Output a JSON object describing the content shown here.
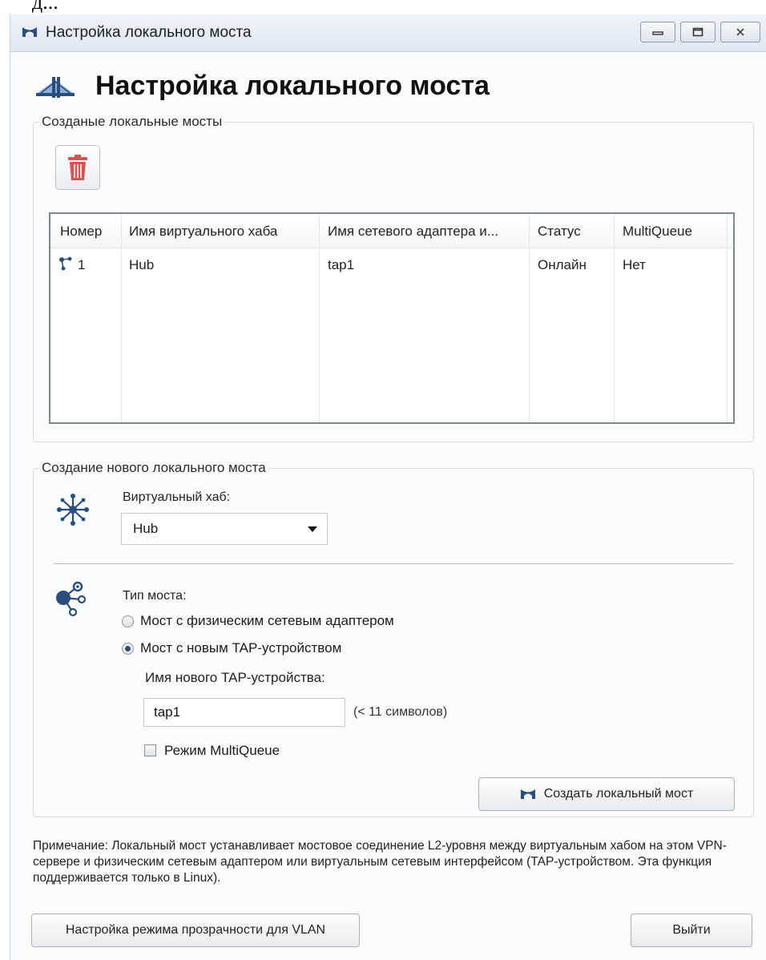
{
  "window": {
    "title": "Настройка локального моста",
    "controls": [
      "minimize",
      "maximize",
      "close"
    ]
  },
  "page": {
    "title": "Настройка локального моста"
  },
  "existing_bridges": {
    "legend": "Созданые локальные мосты",
    "columns": [
      "Номер",
      "Имя виртуального хаба",
      "Имя сетевого адаптера и...",
      "Статус",
      "MultiQueue"
    ],
    "rows": [
      {
        "number": "1",
        "hub": "Hub",
        "adapter": "tap1",
        "status": "Онлайн",
        "multiqueue": "Нет"
      }
    ]
  },
  "new_bridge": {
    "legend": "Создание нового локального моста",
    "hub_label": "Виртуальный хаб:",
    "hub_value": "Hub",
    "type_label": "Тип моста:",
    "option_physical": "Мост с физическим сетевым адаптером",
    "option_tap": "Мост с новым TAP-устройством",
    "selected_option": "tap",
    "tap_name_label": "Имя нового TAP-устройства:",
    "tap_name_value": "tap1",
    "tap_name_hint": "(< 11 символов)",
    "multiqueue_label": "Режим MultiQueue",
    "multiqueue_checked": false,
    "create_button": "Создать локальный мост"
  },
  "note": "Примечание: Локальный мост устанавливает мостовое соединение L2-уровня между виртуальным хабом на этом VPN-сервере и физическим сетевым адаптером или виртуальным сетевым интерфейсом (TAP-устройством. Эта функция поддерживается только в Linux).",
  "footer": {
    "vlan_button": "Настройка режима прозрачности для VLAN",
    "exit_button": "Выйти"
  },
  "colors": {
    "accent": "#2a4e7e",
    "trash": "#e05050"
  }
}
